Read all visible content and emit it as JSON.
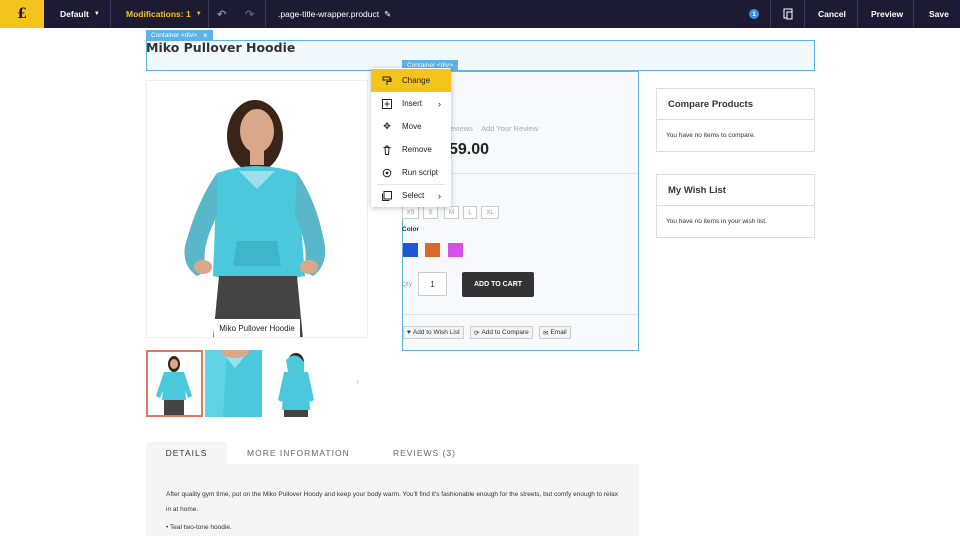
{
  "toolbar": {
    "logo": "£",
    "view_label": "Default",
    "modifications_label": "Modifications: 1",
    "selector_label": ".page-title-wrapper.product",
    "notification_count": "1",
    "cancel_label": "Cancel",
    "preview_label": "Preview",
    "save_label": "Save"
  },
  "tags": {
    "title_container": "Container <div>",
    "title_container_close": "×",
    "product_container": "Container <div>"
  },
  "page_title": "Miko Pullover Hoodie",
  "image_caption": "Miko Pullover Hoodie",
  "context_menu": {
    "items": [
      {
        "label": "Change",
        "icon": "paint-roller-icon"
      },
      {
        "label": "Insert",
        "icon": "insert-box-icon",
        "submenu": true
      },
      {
        "label": "Move",
        "icon": "move-arrows-icon"
      },
      {
        "label": "Remove",
        "icon": "trash-icon"
      },
      {
        "label": "Run script",
        "icon": "script-gear-icon"
      },
      {
        "label": "Select",
        "icon": "select-box-icon",
        "submenu": true
      }
    ]
  },
  "product": {
    "reviews_fragment": "eviews",
    "add_review": "Add Your Review",
    "price_fragment": "59.00",
    "sizes": [
      "XS",
      "S",
      "M",
      "L",
      "XL"
    ],
    "color_label": "Color",
    "colors": [
      "#2255d8",
      "#d7692c",
      "#d451e8"
    ],
    "qty_label": "Qty",
    "qty_value": "1",
    "add_to_cart": "ADD TO CART",
    "wish_list_btn": "Add to Wish List",
    "compare_btn": "Add to Compare",
    "email_btn": "Email"
  },
  "sidebar": {
    "compare_title": "Compare Products",
    "compare_text": "You have no items to compare.",
    "wishlist_title": "My Wish List",
    "wishlist_text": "You have no items in your wish list."
  },
  "tabs": [
    "DETAILS",
    "MORE INFORMATION",
    "REVIEWS (3)"
  ],
  "details_text": "After quality gym time, put on the Miko Pullover Hoody and keep your body warm. You'll find it's fashionable enough for the streets, but comfy enough to relax in at home.",
  "details_bullet": "• Teal two-tone hoodie.",
  "colors": {
    "topbar": "#1d1b33",
    "accent_yellow": "#f5c41c",
    "selection_blue": "#5eb3e6",
    "hoodie_teal": "#4cc8dc"
  }
}
